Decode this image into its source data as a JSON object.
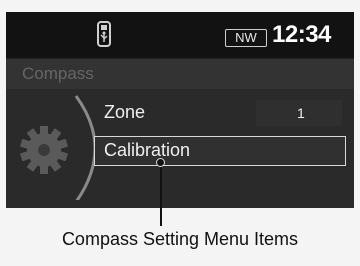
{
  "status_bar": {
    "usb_icon": "usb-device-icon",
    "heading": "NW",
    "time": "12:34"
  },
  "page": {
    "title": "Compass",
    "icon": "gear-icon"
  },
  "menu": {
    "items": [
      {
        "label": "Zone",
        "value": "1",
        "selected": false
      },
      {
        "label": "Calibration",
        "selected": true
      }
    ]
  },
  "callout": {
    "caption": "Compass Setting Menu Items"
  },
  "colors": {
    "screen_background": "#222222",
    "status_bar_background": "#121212",
    "title_bar_background": "#333333",
    "selection_border": "#d8d8d8",
    "text": "#f0f0f0"
  }
}
